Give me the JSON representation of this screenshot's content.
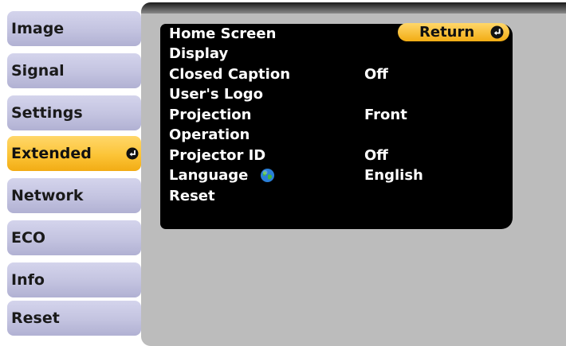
{
  "sidebar": {
    "items": [
      {
        "label": "Image"
      },
      {
        "label": "Signal"
      },
      {
        "label": "Settings"
      },
      {
        "label": "Extended",
        "active": true
      },
      {
        "label": "Network"
      },
      {
        "label": "ECO"
      },
      {
        "label": "Info"
      },
      {
        "label": "Reset"
      }
    ]
  },
  "panel": {
    "return_label": "Return",
    "return_icon": "enter-icon",
    "menu": [
      {
        "label": "Home Screen",
        "value": ""
      },
      {
        "label": "Display",
        "value": ""
      },
      {
        "label": "Closed Caption",
        "value": "Off"
      },
      {
        "label": "User's Logo",
        "value": ""
      },
      {
        "label": "Projection",
        "value": "Front"
      },
      {
        "label": "Operation",
        "value": ""
      },
      {
        "label": "Projector ID",
        "value": "Off"
      },
      {
        "label": "Language",
        "value": "English",
        "icon": "globe-icon"
      },
      {
        "label": "Reset",
        "value": ""
      }
    ]
  },
  "colors": {
    "active_highlight": "#fcc437",
    "inactive_tab": "#c3c3e0",
    "menu_background": "#000000",
    "panel_background": "#bcbcbc"
  }
}
